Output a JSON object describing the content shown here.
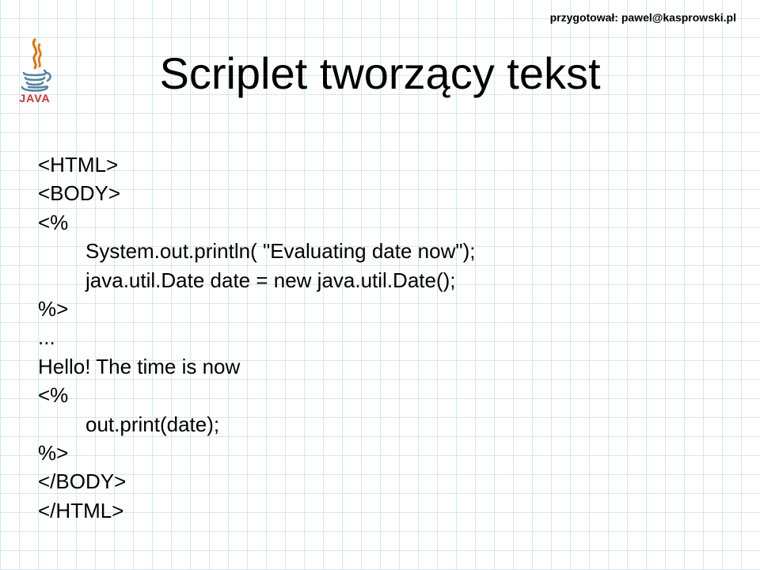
{
  "header": "przygotował: pawel@kasprowski.pl",
  "logo_text": "JAVA",
  "title": "Scriplet tworzący tekst",
  "code": {
    "l1": "<HTML>",
    "l2": "<BODY>",
    "l3": "<%",
    "l4": "System.out.println( \"Evaluating date now\");",
    "l5": "java.util.Date date = new java.util.Date();",
    "l6": "%>",
    "l7": "...",
    "l8": "Hello! The time is now",
    "l9": "<%",
    "l10": "out.print(date);",
    "l11": "%>",
    "l12": "</BODY>",
    "l13": "</HTML>"
  }
}
